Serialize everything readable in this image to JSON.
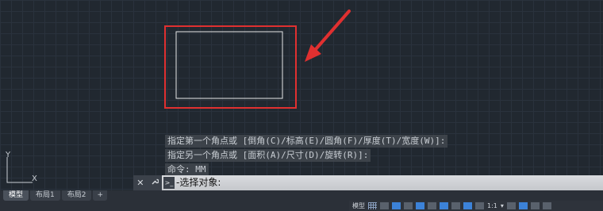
{
  "command_history": [
    "指定第一个角点或 [倒角(C)/标高(E)/圆角(F)/厚度(T)/宽度(W)]:",
    "指定另一个角点或 [面积(A)/尺寸(D)/旋转(R)]:",
    "命令: MM"
  ],
  "command_bar": {
    "close_glyph": "✕",
    "settings_glyph": "🔧",
    "prompt_glyph": ">_",
    "input_text": "-选择对象:"
  },
  "ucs": {
    "x_label": "X",
    "y_label": "Y"
  },
  "layout_tabs": [
    {
      "label": "模型",
      "active": true
    },
    {
      "label": "布局1",
      "active": false
    },
    {
      "label": "布局2",
      "active": false
    }
  ],
  "add_tab_label": "+",
  "status_bar": {
    "model_label": "模型",
    "scale_label": "1:1",
    "overflow_glyph": "▾"
  },
  "colors": {
    "canvas_bg": "#212830",
    "annotation_red": "#e03030",
    "drawing_line": "#e8e8e8"
  }
}
